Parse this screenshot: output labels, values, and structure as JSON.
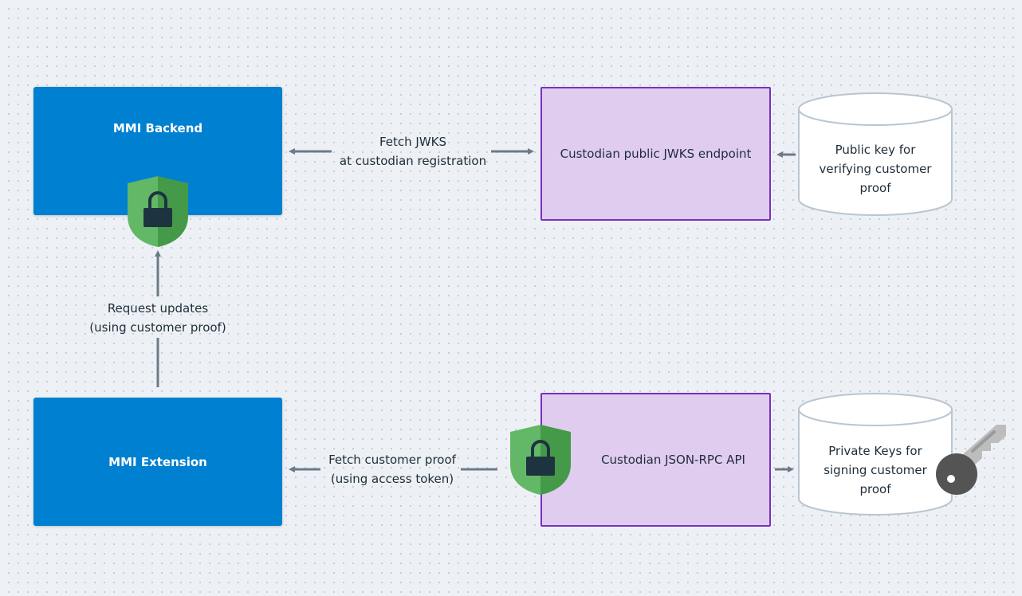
{
  "nodes": {
    "mmi_backend": "MMI Backend",
    "mmi_extension": "MMI Extension",
    "jwks_endpoint": "Custodian public JWKS endpoint",
    "jsonrpc_api": "Custodian JSON-RPC API",
    "public_key_store": [
      "Public key for",
      "verifying customer",
      "proof"
    ],
    "private_key_store": [
      "Private Keys for",
      "signing customer",
      "proof"
    ]
  },
  "edges": {
    "fetch_jwks": [
      "Fetch JWKS",
      "at custodian registration"
    ],
    "request_updates": [
      "Request updates",
      "(using customer proof)"
    ],
    "fetch_proof": [
      "Fetch customer proof",
      "(using access token)"
    ]
  },
  "icons": [
    "shield-lock-icon",
    "shield-lock-icon",
    "key-icon"
  ],
  "colors": {
    "primary": "#0080d0",
    "purple_fill": "#e0ccef",
    "purple_border": "#7b2fbf",
    "arrow": "#6b7b88",
    "shield_light": "#63b867",
    "shield_dark": "#449a48"
  }
}
